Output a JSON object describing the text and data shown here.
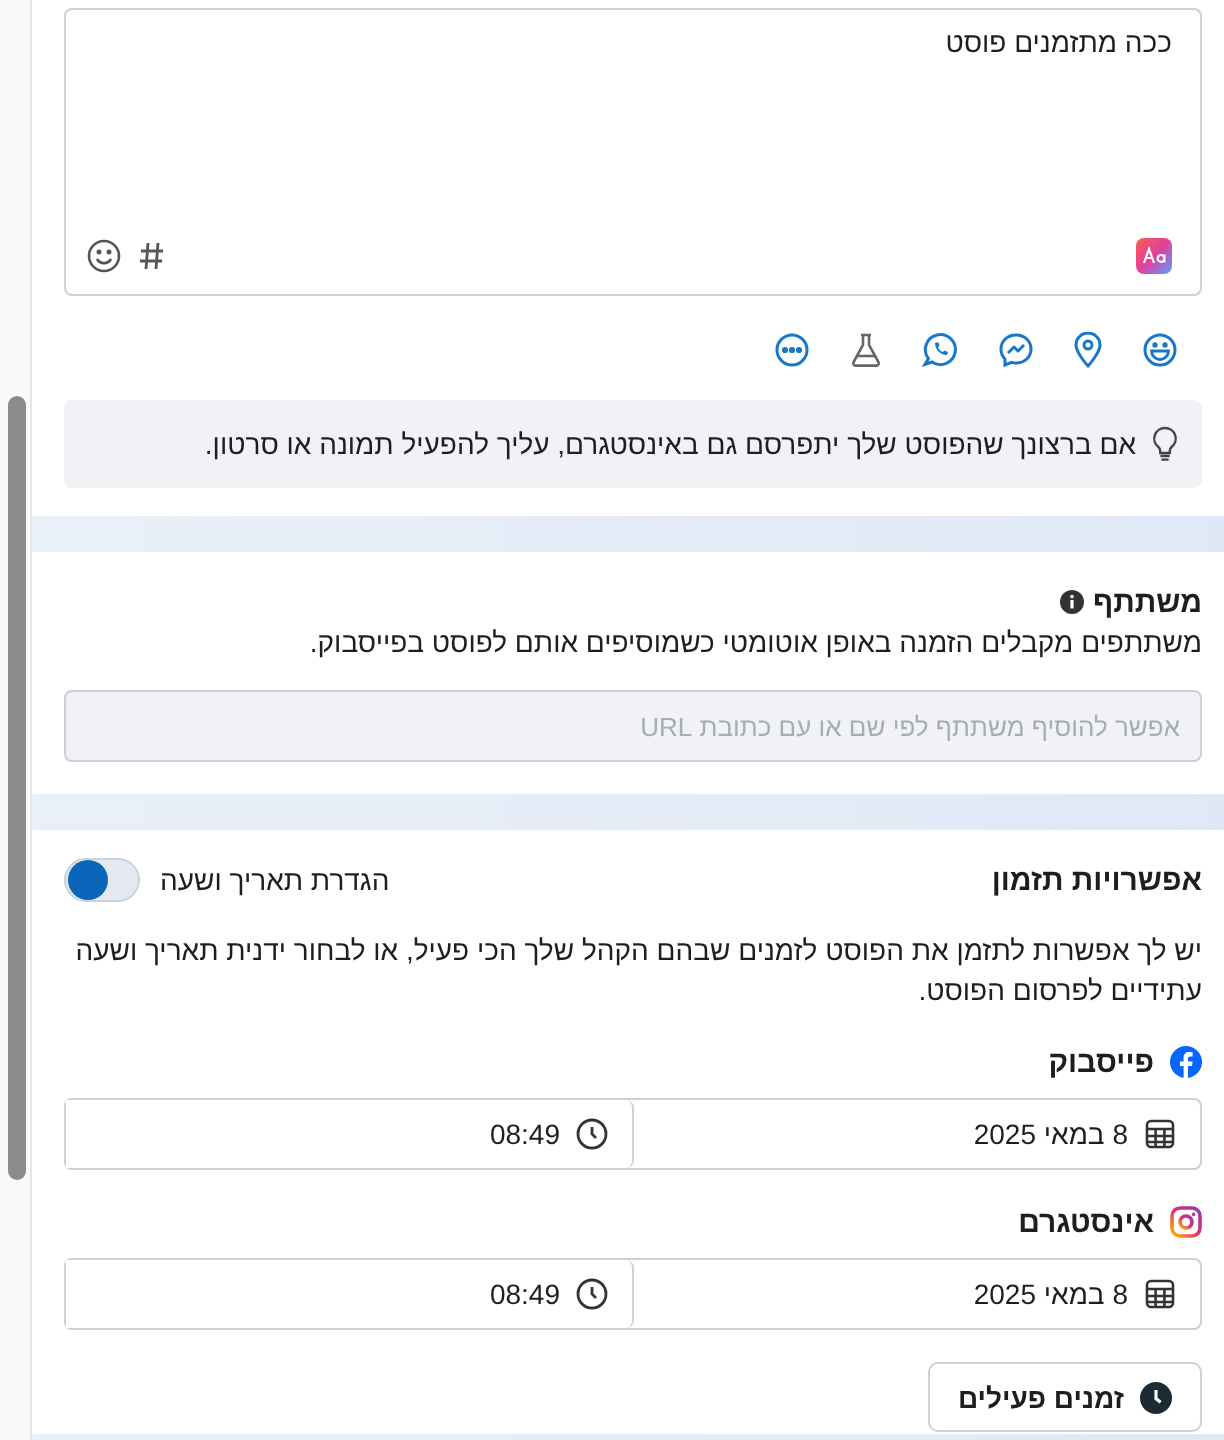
{
  "composer": {
    "value": "ככה מתזמנים פוסט"
  },
  "tip": "אם ברצונך שהפוסט שלך יתפרסם גם באינסטגרם, עליך להפעיל תמונה או סרטון.",
  "partner": {
    "title": "משתתף",
    "description": "משתתפים מקבלים הזמנה באופן אוטומטי כשמוסיפים אותם לפוסט בפייסבוק.",
    "placeholder": "אפשר להוסיף משתתף לפי שם או עם כתובת URL"
  },
  "schedule": {
    "title": "אפשרויות תזמון",
    "toggle": {
      "label": "הגדרת תאריך ושעה",
      "on": false
    },
    "description": "יש לך אפשרות לתזמן את הפוסט לזמנים שבהם הקהל שלך הכי פעיל, או לבחור ידנית תאריך ושעה עתידיים לפרסום הפוסט.",
    "platforms": [
      {
        "kind": "facebook",
        "name": "פייסבוק",
        "date": "8 במאי 2025",
        "time": "08:49"
      },
      {
        "kind": "instagram",
        "name": "אינסטגרם",
        "date": "8 במאי 2025",
        "time": "08:49"
      }
    ],
    "button": "זמנים פעילים"
  }
}
